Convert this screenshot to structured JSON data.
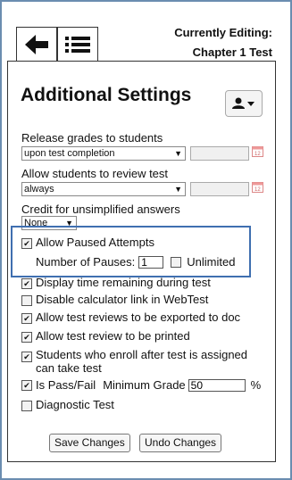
{
  "header": {
    "editing_line1": "Currently Editing:",
    "editing_line2": "Chapter 1 Test",
    "back_icon": "arrow-left-icon",
    "list_icon": "list-icon"
  },
  "settings": {
    "title": "Additional Settings",
    "user_icon": "user-dropdown-icon",
    "release_label": "Release grades to students",
    "release_value": "upon test completion",
    "review_label": "Allow students to review test",
    "review_value": "always",
    "credit_label": "Credit for unsimplified answers",
    "credit_value": "None",
    "paused_label": "Allow Paused Attempts",
    "pauses_label": "Number of Pauses:",
    "pauses_value": "1",
    "unlimited_label": "Unlimited",
    "display_time_label": "Display time remaining during test",
    "disable_calc_label": "Disable calculator link in WebTest",
    "export_label": "Allow test reviews to be exported to doc",
    "print_label": "Allow test review to be printed",
    "enroll_label": "Students who enroll after test is assigned can take test",
    "passfail_label": "Is Pass/Fail",
    "min_grade_label": "Minimum Grade",
    "min_grade_value": "50",
    "percent_label": "%",
    "diagnostic_label": "Diagnostic Test"
  },
  "checkboxes": {
    "paused": true,
    "unlimited": false,
    "display_time": true,
    "disable_calc": false,
    "export": true,
    "print": true,
    "enroll": true,
    "passfail": true,
    "diagnostic": false
  },
  "buttons": {
    "save": "Save Changes",
    "undo": "Undo Changes"
  }
}
